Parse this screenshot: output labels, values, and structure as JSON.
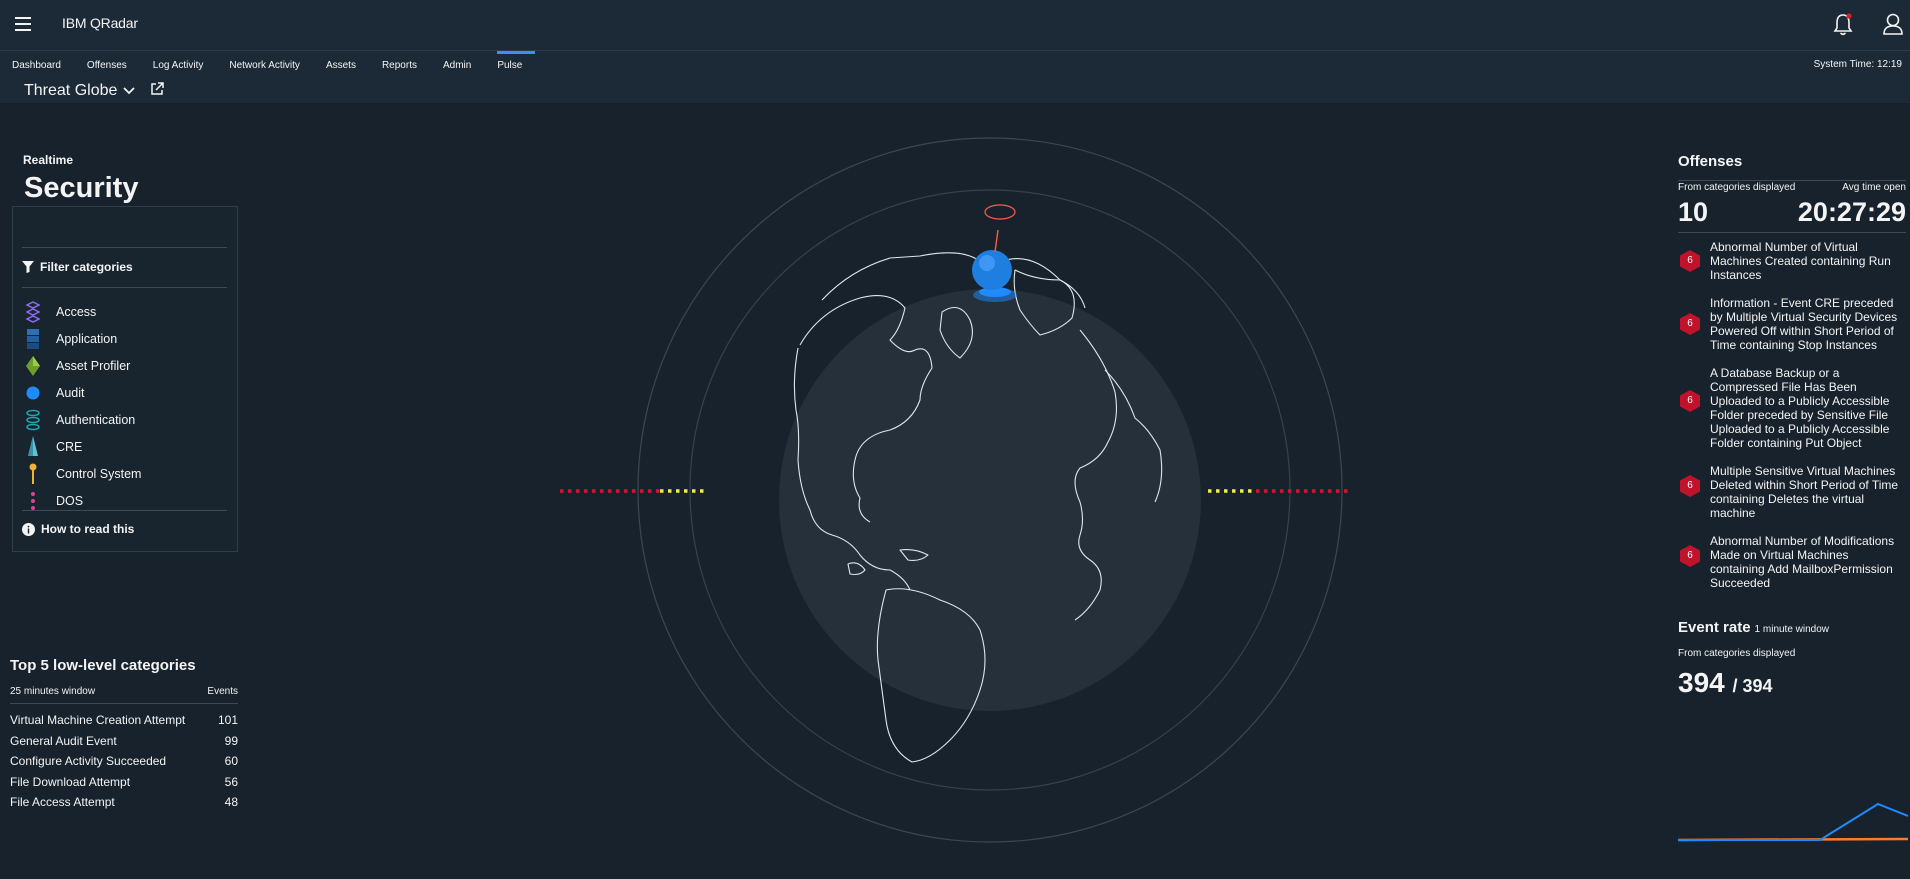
{
  "app": {
    "brand": "IBM QRadar"
  },
  "nav": {
    "tabs": [
      "Dashboard",
      "Offenses",
      "Log Activity",
      "Network Activity",
      "Assets",
      "Reports",
      "Admin",
      "Pulse"
    ],
    "active": "Pulse",
    "system_time": "System Time: 12:19"
  },
  "page": {
    "title": "Threat Globe"
  },
  "left": {
    "realtime": "Realtime",
    "title": "Security events",
    "filter_label": "Filter categories",
    "categories": [
      {
        "label": "Access",
        "icon": "access-icon",
        "color": "#8a6cf0"
      },
      {
        "label": "Application",
        "icon": "application-icon",
        "color": "#2f6fb3"
      },
      {
        "label": "Asset Profiler",
        "icon": "asset-profiler-icon",
        "color": "#6a9f2e"
      },
      {
        "label": "Audit",
        "icon": "audit-icon",
        "color": "#1f8bff"
      },
      {
        "label": "Authentication",
        "icon": "authentication-icon",
        "color": "#1fa7b0"
      },
      {
        "label": "CRE",
        "icon": "cre-icon",
        "color": "#5fc3d8"
      },
      {
        "label": "Control System",
        "icon": "control-system-icon",
        "color": "#f2b233"
      },
      {
        "label": "DOS",
        "icon": "dos-icon",
        "color": "#e0409a"
      }
    ],
    "how_to": "How to read this",
    "top5": {
      "title": "Top 5 low-level categories",
      "window": "25 minutes window",
      "events_header": "Events",
      "rows": [
        {
          "name": "Virtual Machine Creation Attempt",
          "count": "101"
        },
        {
          "name": "General Audit Event",
          "count": "99"
        },
        {
          "name": "Configure Activity Succeeded",
          "count": "60"
        },
        {
          "name": "File Download Attempt",
          "count": "56"
        },
        {
          "name": "File Access Attempt",
          "count": "48"
        }
      ]
    }
  },
  "right": {
    "offenses_title": "Offenses",
    "from_label": "From categories displayed",
    "avg_label": "Avg time open",
    "count": "10",
    "avg_time": "20:27:29",
    "offenses": [
      {
        "severity": "6",
        "text": "Abnormal Number of Virtual Machines Created containing Run Instances"
      },
      {
        "severity": "6",
        "text": "Information - Event CRE preceded by Multiple Virtual Security Devices Powered Off within Short Period of Time containing Stop Instances"
      },
      {
        "severity": "6",
        "text": "A Database Backup or a Compressed File Has Been Uploaded to a Publicly Accessible Folder preceded by Sensitive File Uploaded to a Publicly Accessible Folder containing Put Object"
      },
      {
        "severity": "6",
        "text": "Multiple Sensitive Virtual Machines Deleted within Short Period of Time containing Deletes the virtual machine"
      },
      {
        "severity": "6",
        "text": "Abnormal Number of Modifications Made on Virtual Machines containing Add MailboxPermission Succeeded"
      }
    ],
    "event_rate_title": "Event rate",
    "event_rate_window": "1 minute window",
    "event_rate_from": "From categories displayed",
    "event_rate_value": "394",
    "event_rate_total": "/ 394"
  },
  "colors": {
    "accent": "#4589ff",
    "severity": "#c0122a",
    "series_blue": "#1f8bff",
    "series_orange": "#ff7a2a"
  }
}
